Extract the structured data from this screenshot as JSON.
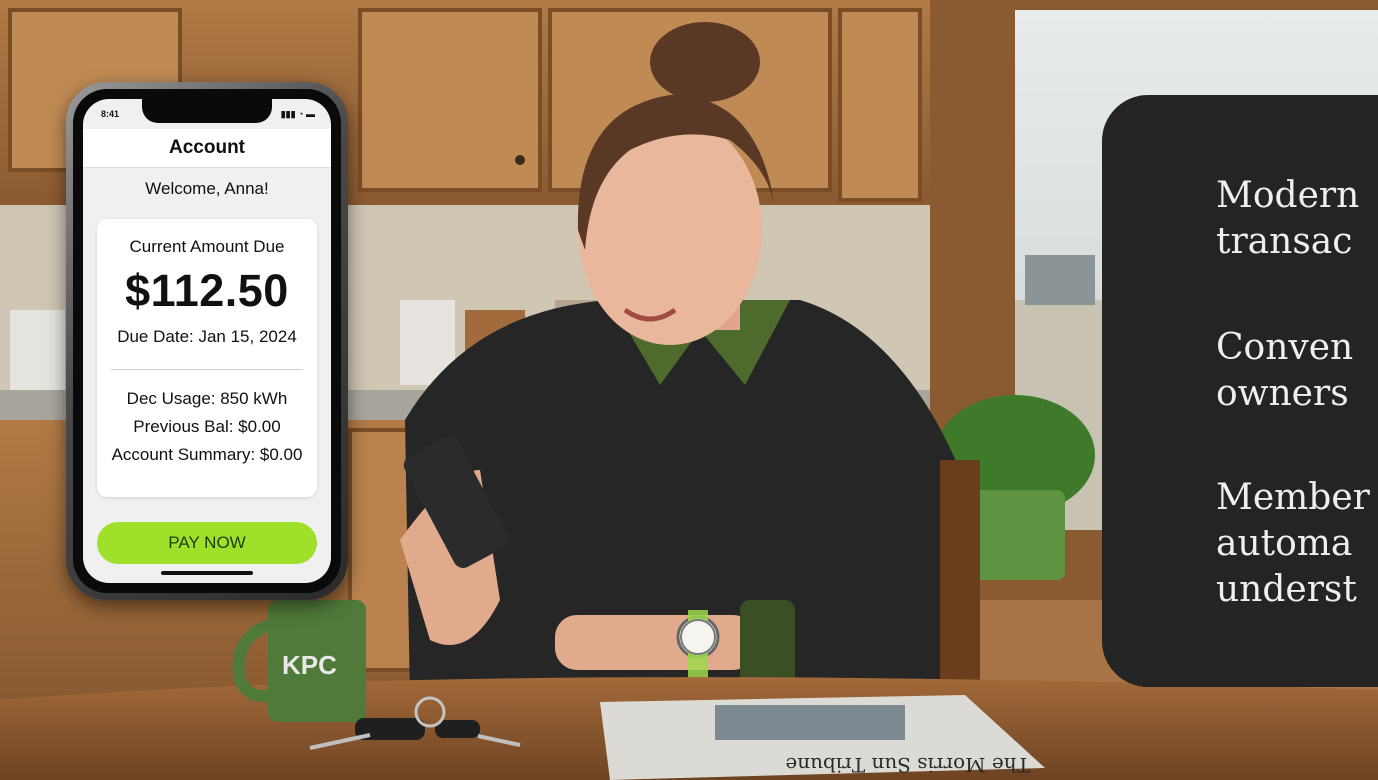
{
  "phone": {
    "status_time": "8:41",
    "status_icons": "▮▮▮ ◔ ▬",
    "header_title": "Account",
    "welcome": "Welcome, Anna!",
    "card": {
      "title": "Current Amount Due",
      "amount": "$112.50",
      "due_date": "Due Date: Jan 15, 2024",
      "usage": "Dec Usage: 850 kWh",
      "previous_balance": "Previous Bal: $0.00",
      "account_summary": "Account Summary: $0.00"
    },
    "pay_button": "PAY NOW",
    "accent_color": "#9fe02a"
  },
  "mug": {
    "logo": "KPC"
  },
  "newspaper": {
    "masthead": "The Morris Sun Tribune"
  },
  "panel": {
    "lines": [
      "Modern",
      "transac",
      "Conven",
      "owners",
      "Member",
      "automa",
      "underst"
    ]
  }
}
